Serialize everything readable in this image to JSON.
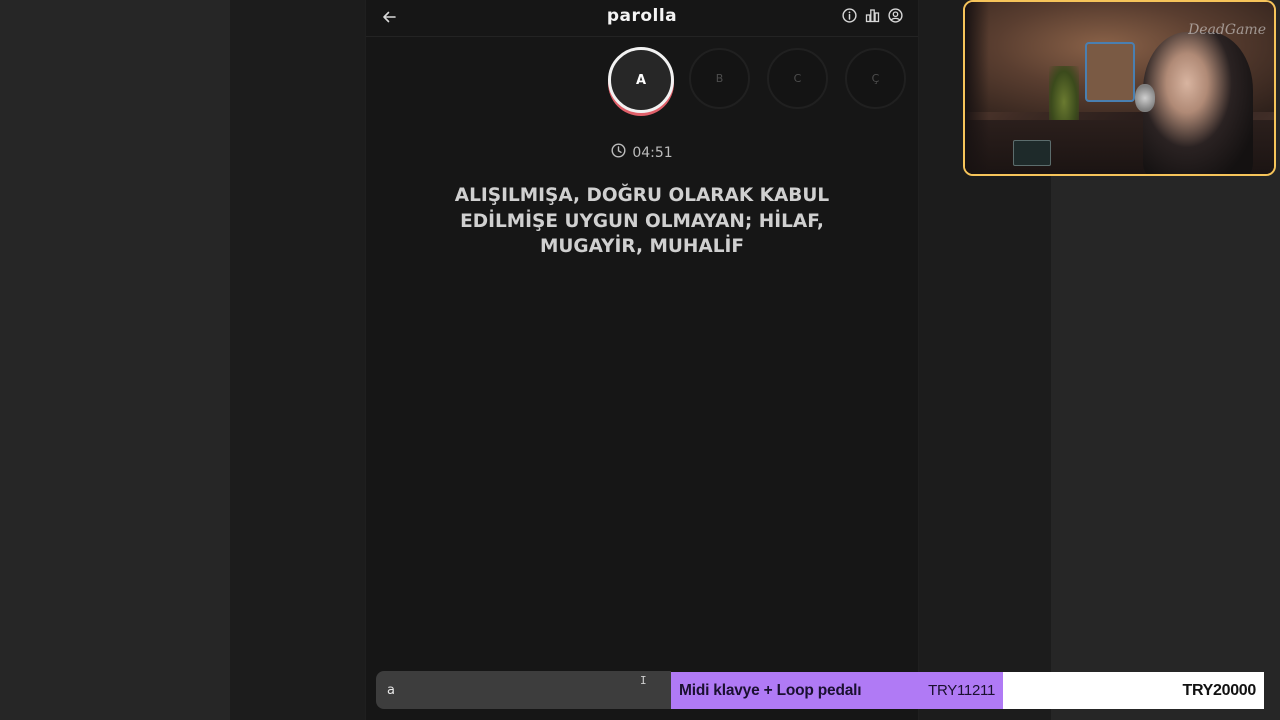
{
  "game": {
    "title": "parolla",
    "letters": [
      {
        "char": "A",
        "state": "active"
      },
      {
        "char": "B",
        "state": "idle"
      },
      {
        "char": "C",
        "state": "idle"
      },
      {
        "char": "Ç",
        "state": "idle"
      }
    ],
    "timer": "04:51",
    "question": "ALIŞILMIŞA, DOĞRU OLARAK KABUL EDİLMİŞE UYGUN OLMAYAN; HİLAF, MUGAYİR, MUHALİF",
    "answer_value": "a"
  },
  "header_icons": {
    "back": "arrow-left-icon",
    "info": "info-icon",
    "stats": "bar-chart-icon",
    "profile": "user-circle-icon"
  },
  "donation": {
    "item": "Midi klavye + Loop pedalı",
    "amount": "TRY11211",
    "goal": "TRY20000"
  },
  "webcam": {
    "watermark": "DeadGame"
  },
  "colors": {
    "active_ring": "#f2f2f2",
    "active_accent": "#e0606a",
    "donation_purple": "#b07af5",
    "webcam_border": "#f6c45a"
  }
}
